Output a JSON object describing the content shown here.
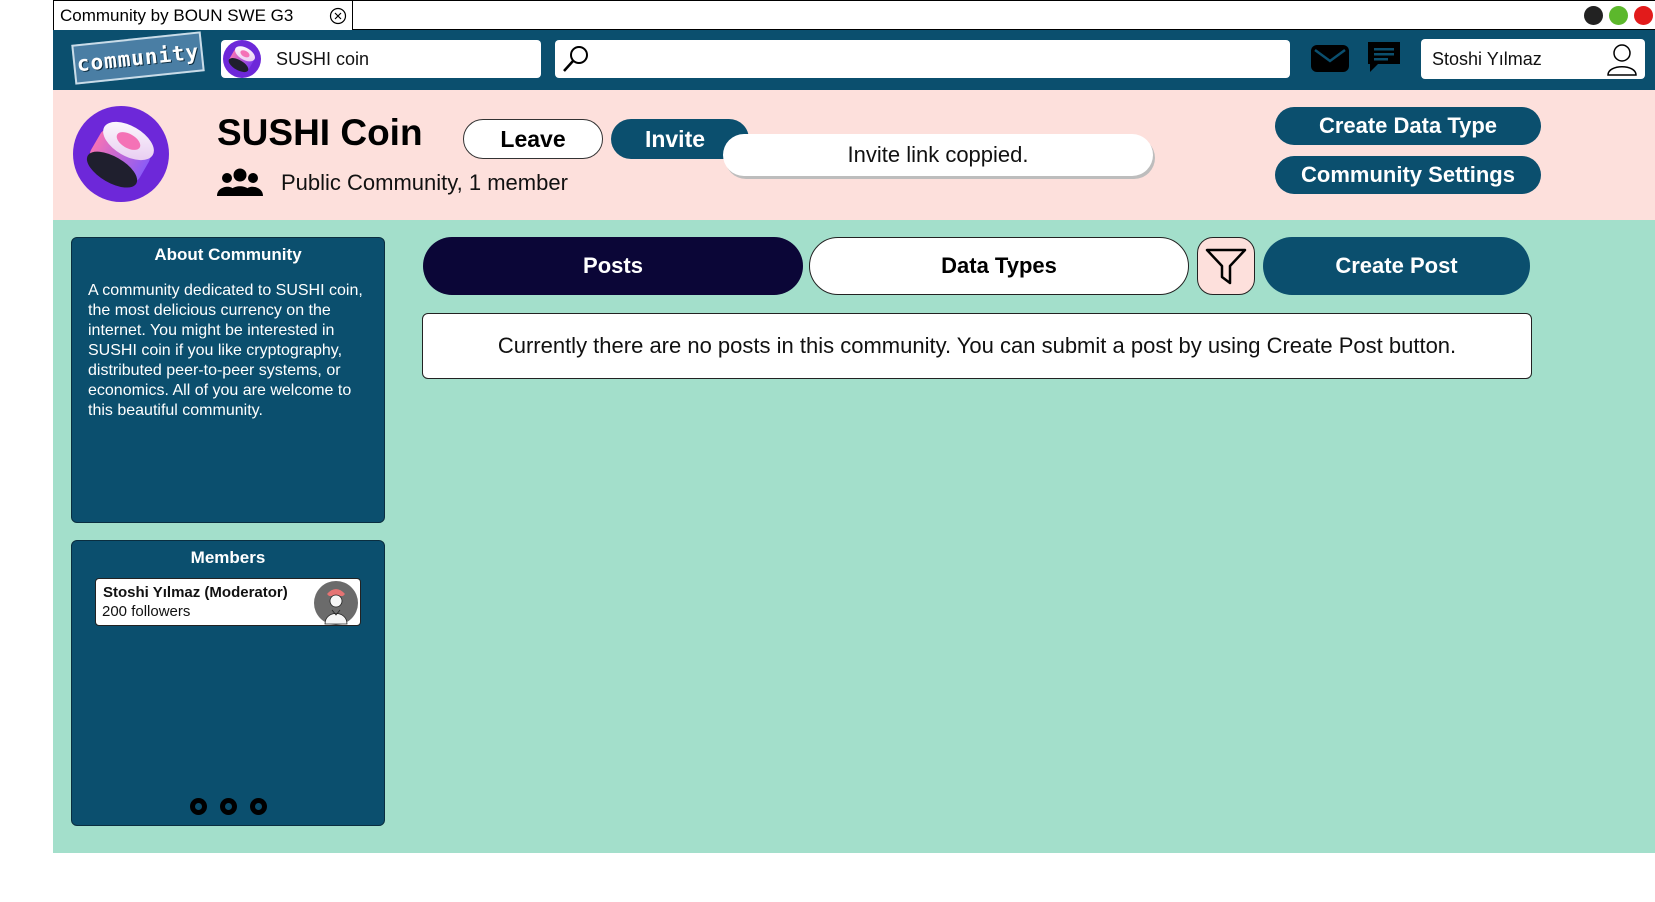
{
  "window": {
    "tab_title": "Community by BOUN SWE G3",
    "close_icon": "circle-x-icon",
    "controls": [
      {
        "name": "minimize-dot",
        "color": "#222222"
      },
      {
        "name": "maximize-dot",
        "color": "#5cb82c"
      },
      {
        "name": "close-dot",
        "color": "#e21b1b"
      }
    ]
  },
  "topbar": {
    "logo_text": "community",
    "current_community": "SUSHI coin",
    "search": {
      "value": "",
      "icon": "search-icon"
    },
    "icons": [
      "mail-icon",
      "chat-icon"
    ],
    "user_name": "Stoshi Yılmaz",
    "user_icon": "user-icon"
  },
  "header": {
    "title": "SUSHI Coin",
    "leave_label": "Leave",
    "invite_label": "Invite",
    "toast": "Invite link coppied.",
    "meta": "Public Community, 1 member",
    "create_data_type_label": "Create Data Type",
    "settings_label": "Community Settings"
  },
  "about": {
    "title": "About Community",
    "text": "A community dedicated to SUSHI coin, the most delicious currency on the internet. You might be interested in SUSHI coin if you like cryptography, distributed peer-to-peer systems, or economics. All of you are welcome to this beautiful community."
  },
  "members": {
    "title": "Members",
    "items": [
      {
        "name": "Stoshi Yılmaz (Moderator)",
        "followers": "200 followers"
      }
    ],
    "pager_icon": "more-dots-icon"
  },
  "main": {
    "tabs": [
      {
        "label": "Posts",
        "active": true
      },
      {
        "label": "Data Types",
        "active": false
      }
    ],
    "filter_icon": "filter-icon",
    "create_post_label": "Create Post",
    "empty_message": "Currently there are no posts in this community. You can submit a post by using Create Post button."
  },
  "colors": {
    "primary": "#0b4f6e",
    "active_tab": "#0b0637",
    "header_bg": "#fde0dc",
    "content_bg": "#a3dfcb"
  }
}
